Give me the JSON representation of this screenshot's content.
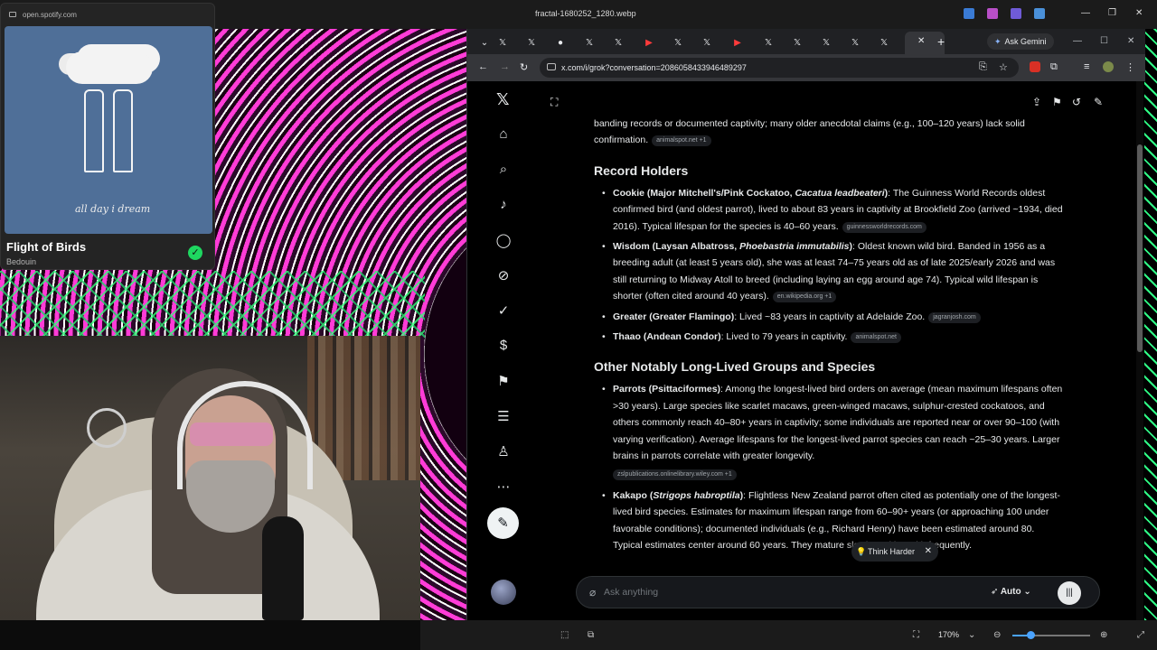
{
  "viewer": {
    "title": "fractal-1680252_1280.webp",
    "zoom": "170%",
    "minimize": "—",
    "maximize": "❐",
    "close": "✕"
  },
  "spotify": {
    "url": "open.spotify.com",
    "album_caption": "all day i dream",
    "track": "Flight of Birds",
    "artist": "Bedouin"
  },
  "browser": {
    "ask_gemini": "Ask Gemini",
    "url": "x.com/i/grok?conversation=2086058433946489297",
    "new_tab": "+",
    "tab_close": "✕"
  },
  "grok": {
    "intro_text": "banding records or documented captivity; many older anecdotal claims (e.g., 100–120 years) lack solid confirmation.",
    "intro_source": "animalspot.net +1",
    "sections": [
      {
        "heading": "Record Holders",
        "items": [
          {
            "title_before": "Cookie (Major Mitchell's/Pink Cockatoo, ",
            "title_italic": "Cacatua leadbeateri",
            "title_after": ")",
            "text": ": The Guinness World Records oldest confirmed bird (and oldest parrot), lived to about 83 years in captivity at Brookfield Zoo (arrived ~1934, died 2016). Typical lifespan for the species is 40–60 years.",
            "source": "guinnessworldrecords.com"
          },
          {
            "title_before": "Wisdom (Laysan Albatross, ",
            "title_italic": "Phoebastria immutabilis",
            "title_after": ")",
            "text": ": Oldest known wild bird. Banded in 1956 as a breeding adult (at least 5 years old), she was at least 74–75 years old as of late 2025/early 2026 and was still returning to Midway Atoll to breed (including laying an egg around age 74). Typical wild lifespan is shorter (often cited around 40 years).",
            "source": "en.wikipedia.org +1"
          },
          {
            "title_before": "Greater (Greater Flamingo)",
            "title_italic": "",
            "title_after": "",
            "text": ": Lived ~83 years in captivity at Adelaide Zoo.",
            "source": "jagranjosh.com"
          },
          {
            "title_before": "Thaao (Andean Condor)",
            "title_italic": "",
            "title_after": "",
            "text": ": Lived to 79 years in captivity.",
            "source": "animalspot.net"
          }
        ]
      },
      {
        "heading": "Other Notably Long-Lived Groups and Species",
        "items": [
          {
            "title_before": "Parrots (Psittaciformes)",
            "title_italic": "",
            "title_after": "",
            "text": ": Among the longest-lived bird orders on average (mean maximum lifespans often >30 years). Large species like scarlet macaws, green-winged macaws, sulphur-crested cockatoos, and others commonly reach 40–80+ years in captivity; some individuals are reported near or over 90–100 (with varying verification). Average lifespans for the longest-lived parrot species can reach ~25–30 years. Larger brains in parrots correlate with greater longevity.",
            "source": "zslpublications.onlinelibrary.wiley.com +1"
          },
          {
            "title_before": "Kakapo (",
            "title_italic": "Strigops habroptila",
            "title_after": ")",
            "text": ": Flightless New Zealand parrot often cited as potentially one of the longest-lived bird species. Estimates for maximum lifespan range from 60–90+ years (or approaching 100 under favorable conditions); documented individuals (e.g., Richard Henry) have been estimated around 80. Typical estimates center around 60 years. They mature slowly and breed infrequently.",
            "source": ""
          }
        ]
      }
    ],
    "think_harder": "Think Harder",
    "ask_placeholder": "Ask anything",
    "mode": "Auto"
  },
  "icons": {
    "x_logo": "x-logo-icon",
    "home": "home-icon",
    "search": "search-icon",
    "notifications": "bell-icon",
    "messages": "message-icon",
    "grok": "grok-icon",
    "verified": "check-circle-icon",
    "premium": "dollar-icon",
    "bookmarks": "bookmark-icon",
    "lists": "list-icon",
    "profile": "person-icon",
    "more": "more-icon",
    "compose": "compose-icon"
  },
  "colors": {
    "spotify_green": "#1ed760",
    "album_blue": "#4f6f98",
    "fractal_magenta": "#ff3cd7",
    "fractal_green": "#33ff7a"
  }
}
